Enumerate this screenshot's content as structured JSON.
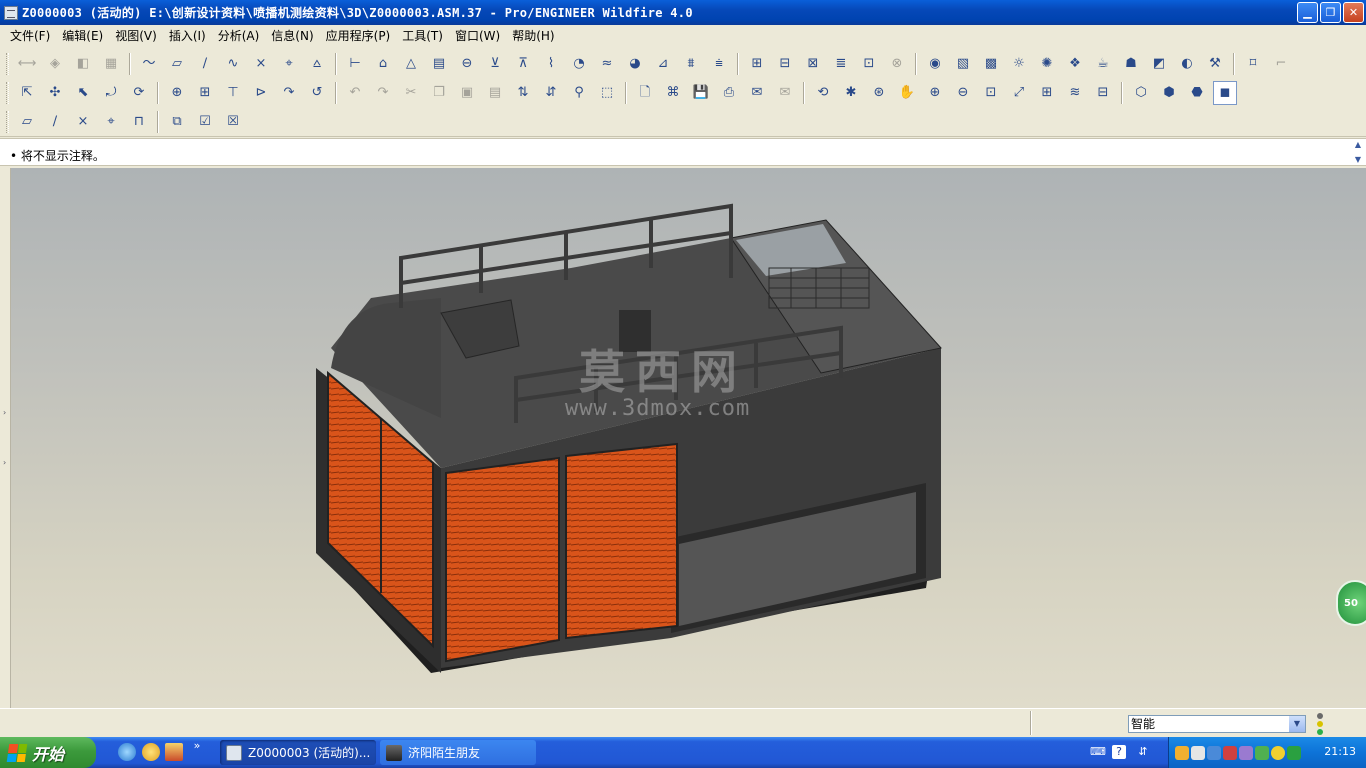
{
  "window": {
    "title": "Z0000003 (活动的) E:\\创新设计资料\\喷播机测绘资料\\3D\\Z0000003.ASM.37 - Pro/ENGINEER Wildfire 4.0",
    "buttons": [
      "minimize",
      "restore",
      "close"
    ]
  },
  "menu": [
    "文件(F)",
    "编辑(E)",
    "视图(V)",
    "插入(I)",
    "分析(A)",
    "信息(N)",
    "应用程序(P)",
    "工具(T)",
    "窗口(W)",
    "帮助(H)"
  ],
  "toolbars": {
    "row1": [
      {
        "group": [
          {
            "icon": "mirror-icon",
            "glyph": "⟷",
            "dim": true
          },
          {
            "icon": "merge-icon",
            "glyph": "◈",
            "dim": true
          },
          {
            "icon": "trim-icon",
            "glyph": "◧",
            "dim": true
          },
          {
            "icon": "pattern-icon",
            "glyph": "▦",
            "dim": true
          }
        ]
      },
      {
        "group": [
          {
            "icon": "datum-curve-sketch-icon",
            "glyph": "〜"
          },
          {
            "icon": "datum-plane-icon",
            "glyph": "▱"
          },
          {
            "icon": "datum-axis-icon",
            "glyph": "∕"
          },
          {
            "icon": "datum-curve-icon",
            "glyph": "∿"
          },
          {
            "icon": "datum-point-icon",
            "glyph": "×"
          },
          {
            "icon": "datum-csys-icon",
            "glyph": "⌖"
          },
          {
            "icon": "analysis-feature-icon",
            "glyph": "⩟"
          }
        ]
      },
      {
        "group": [
          {
            "icon": "dimension-icon",
            "glyph": "⊢"
          },
          {
            "icon": "datum-tag-icon",
            "glyph": "⌂"
          },
          {
            "icon": "datum-target-icon",
            "glyph": "△"
          },
          {
            "icon": "table-icon",
            "glyph": "▤"
          },
          {
            "icon": "balloon-icon",
            "glyph": "⊖"
          },
          {
            "icon": "notes-icon",
            "glyph": "⊻"
          },
          {
            "icon": "surface-finish-icon",
            "glyph": "⊼"
          },
          {
            "icon": "curve-analysis-icon",
            "glyph": "⌇"
          },
          {
            "icon": "curvature-icon",
            "glyph": "◔"
          },
          {
            "icon": "reflection-icon",
            "glyph": "≈"
          },
          {
            "icon": "shading-analysis-icon",
            "glyph": "◕"
          },
          {
            "icon": "draft-icon",
            "glyph": "⊿"
          },
          {
            "icon": "offset-icon",
            "glyph": "⩩"
          },
          {
            "icon": "deviation-icon",
            "glyph": "⩧"
          }
        ]
      },
      {
        "group": [
          {
            "icon": "model-tree-icon",
            "glyph": "⊞"
          },
          {
            "icon": "layer-tree-icon",
            "glyph": "⊟"
          },
          {
            "icon": "relations-icon",
            "glyph": "⊠"
          },
          {
            "icon": "parameters-icon",
            "glyph": "≣"
          },
          {
            "icon": "family-table-icon",
            "glyph": "⊡"
          },
          {
            "icon": "program-icon",
            "glyph": "⊗",
            "dim": true
          }
        ]
      },
      {
        "group": [
          {
            "icon": "appearance-icon",
            "glyph": "◉"
          },
          {
            "icon": "scene-icon",
            "glyph": "▧"
          },
          {
            "icon": "room-icon",
            "glyph": "▩"
          },
          {
            "icon": "light-icon",
            "glyph": "☼"
          },
          {
            "icon": "effects-icon",
            "glyph": "✺"
          },
          {
            "icon": "render-icon",
            "glyph": "❖"
          },
          {
            "icon": "teapot-icon",
            "glyph": "☕"
          },
          {
            "icon": "teapot-render-icon",
            "glyph": "☗"
          },
          {
            "icon": "decal-icon",
            "glyph": "◩"
          },
          {
            "icon": "perspective-icon",
            "glyph": "◐"
          },
          {
            "icon": "tools-icon",
            "glyph": "⚒"
          }
        ]
      },
      {
        "group": [
          {
            "icon": "annotation-on-icon",
            "glyph": "⌑"
          },
          {
            "icon": "annotation-off-icon",
            "glyph": "⌐",
            "dim": true
          }
        ]
      }
    ],
    "row2": [
      {
        "group": [
          {
            "icon": "move-icon",
            "glyph": "⇱"
          },
          {
            "icon": "rotate-icon",
            "glyph": "✣"
          },
          {
            "icon": "orient-icon",
            "glyph": "⬉"
          },
          {
            "icon": "reorient-icon",
            "glyph": "⤾"
          },
          {
            "icon": "spin-icon",
            "glyph": "⟳"
          }
        ]
      },
      {
        "group": [
          {
            "icon": "assemble-icon",
            "glyph": "⊕"
          },
          {
            "icon": "create-part-icon",
            "glyph": "⊞"
          },
          {
            "icon": "copy-geometry-icon",
            "glyph": "⊤"
          },
          {
            "icon": "publish-geom-icon",
            "glyph": "⊳"
          },
          {
            "icon": "flex-icon",
            "glyph": "↷"
          },
          {
            "icon": "sync-icon",
            "glyph": "↺"
          }
        ]
      },
      {
        "group": [
          {
            "icon": "undo-icon",
            "glyph": "↶",
            "dim": true
          },
          {
            "icon": "redo-icon",
            "glyph": "↷",
            "dim": true
          },
          {
            "icon": "cut-icon",
            "glyph": "✂",
            "dim": true
          },
          {
            "icon": "copy-icon",
            "glyph": "❐",
            "dim": true
          },
          {
            "icon": "paste-icon",
            "glyph": "▣",
            "dim": true
          },
          {
            "icon": "paste-special-icon",
            "glyph": "▤",
            "dim": true
          },
          {
            "icon": "regenerate-icon",
            "glyph": "⇅"
          },
          {
            "icon": "regen-manager-icon",
            "glyph": "⇵"
          },
          {
            "icon": "find-icon",
            "glyph": "⚲"
          },
          {
            "icon": "select-box-icon",
            "glyph": "⬚"
          }
        ]
      },
      {
        "group": [
          {
            "icon": "new-icon",
            "glyph": "🗋"
          },
          {
            "icon": "open-icon",
            "glyph": "⌘"
          },
          {
            "icon": "save-icon",
            "glyph": "💾"
          },
          {
            "icon": "print-icon",
            "glyph": "⎙"
          },
          {
            "icon": "email-icon",
            "glyph": "✉"
          },
          {
            "icon": "email-link-icon",
            "glyph": "✉",
            "dim": true
          }
        ]
      },
      {
        "group": [
          {
            "icon": "redraw-icon",
            "glyph": "⟲"
          },
          {
            "icon": "spin-center-icon",
            "glyph": "✱"
          },
          {
            "icon": "orient-mode-icon",
            "glyph": "⊛"
          },
          {
            "icon": "pan-icon",
            "glyph": "✋"
          },
          {
            "icon": "zoom-in-icon",
            "glyph": "⊕"
          },
          {
            "icon": "zoom-out-icon",
            "glyph": "⊖"
          },
          {
            "icon": "refit-icon",
            "glyph": "⊡"
          },
          {
            "icon": "reorient-view-icon",
            "glyph": "⤢"
          },
          {
            "icon": "saved-views-icon",
            "glyph": "⊞"
          },
          {
            "icon": "layers-icon",
            "glyph": "≋"
          },
          {
            "icon": "view-manager-icon",
            "glyph": "⊟"
          }
        ]
      },
      {
        "group": [
          {
            "icon": "wireframe-icon",
            "glyph": "⬡"
          },
          {
            "icon": "hidden-line-icon",
            "glyph": "⬢"
          },
          {
            "icon": "no-hidden-icon",
            "glyph": "⬣"
          },
          {
            "icon": "shading-icon",
            "glyph": "◼",
            "pressed": true
          }
        ]
      }
    ],
    "row3": [
      {
        "group": [
          {
            "icon": "datum-planes-display-icon",
            "glyph": "▱"
          },
          {
            "icon": "datum-axes-display-icon",
            "glyph": "∕"
          },
          {
            "icon": "point-display-icon",
            "glyph": "×"
          },
          {
            "icon": "csys-display-icon",
            "glyph": "⌖"
          },
          {
            "icon": "annotation-display-icon",
            "glyph": "⊓"
          }
        ]
      },
      {
        "group": [
          {
            "icon": "window-activate-icon",
            "glyph": "⧉"
          },
          {
            "icon": "window-open-icon",
            "glyph": "☑"
          },
          {
            "icon": "window-close-icon",
            "glyph": "☒"
          }
        ]
      }
    ]
  },
  "message": {
    "bullet": "•",
    "text": "将不显示注释。"
  },
  "viewport": {
    "watermark": "莫西网",
    "watermark_url": "www.3dmox.com",
    "badge": "50"
  },
  "status": {
    "filter": "智能"
  },
  "taskbar": {
    "start": "开始",
    "tasks": [
      {
        "label": "Z0000003 (活动的)...",
        "active": true
      },
      {
        "label": "济阳陌生朋友",
        "active": false
      }
    ],
    "clock": "21:13"
  },
  "colors": {
    "machine_body": "#3a3a3a",
    "panels": "#d9541a",
    "titlebar": "#0a5fd9"
  }
}
